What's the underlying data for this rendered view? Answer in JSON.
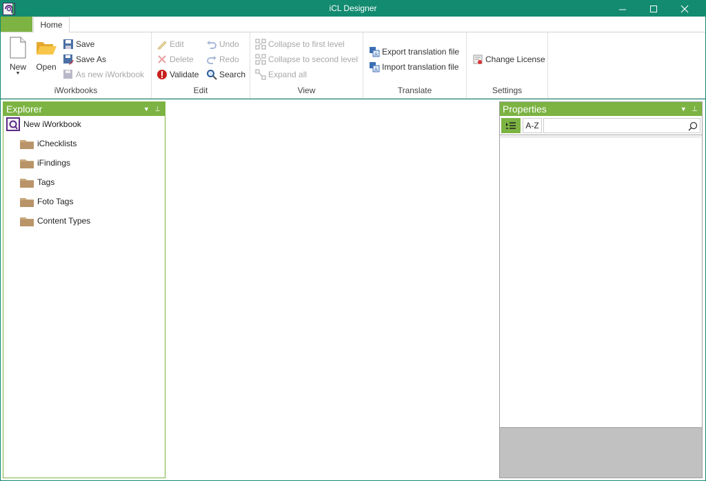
{
  "window": {
    "title": "iCL Designer"
  },
  "tabs": {
    "file_label": "",
    "home_label": "Home"
  },
  "ribbon": {
    "iworkbooks": {
      "group_label": "iWorkbooks",
      "new_label": "New",
      "open_label": "Open",
      "save_label": "Save",
      "save_as_label": "Save As",
      "as_new_label": "As new iWorkbook"
    },
    "edit": {
      "group_label": "Edit",
      "edit_label": "Edit",
      "delete_label": "Delete",
      "validate_label": "Validate",
      "undo_label": "Undo",
      "redo_label": "Redo",
      "search_label": "Search"
    },
    "view": {
      "group_label": "View",
      "collapse_first_label": "Collapse to first level",
      "collapse_second_label": "Collapse to second level",
      "expand_all_label": "Expand all"
    },
    "translate": {
      "group_label": "Translate",
      "export_label": "Export translation file",
      "import_label": "Import translation file"
    },
    "settings": {
      "group_label": "Settings",
      "change_license_label": "Change License"
    }
  },
  "explorer": {
    "title": "Explorer",
    "root_label": "New iWorkbook",
    "items": [
      "iChecklists",
      "iFindings",
      "Tags",
      "Foto Tags",
      "Content Types"
    ]
  },
  "properties": {
    "title": "Properties",
    "az_label": "A-Z",
    "search_value": ""
  },
  "colors": {
    "titlebar": "#138b71",
    "accent_green": "#7cb342",
    "folder": "#c8a87c",
    "logo_purple": "#5b2a86"
  }
}
